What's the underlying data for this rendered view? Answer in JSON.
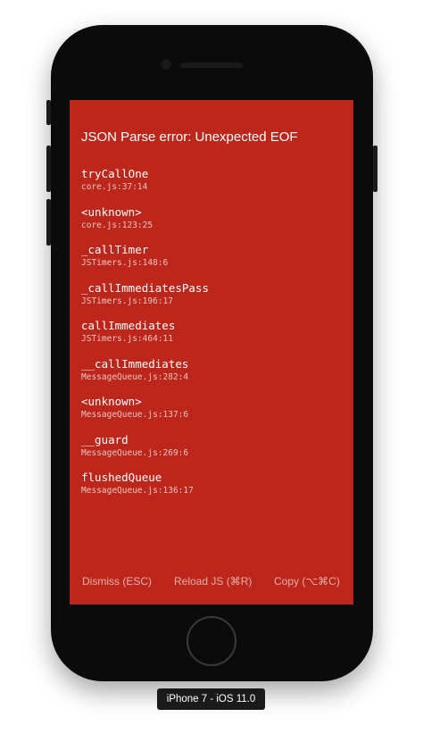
{
  "error": {
    "title": "JSON Parse error: Unexpected EOF"
  },
  "stack": [
    {
      "method": "tryCallOne",
      "file": "core.js:37:14"
    },
    {
      "method": "<unknown>",
      "file": "core.js:123:25"
    },
    {
      "method": "_callTimer",
      "file": "JSTimers.js:148:6"
    },
    {
      "method": "_callImmediatesPass",
      "file": "JSTimers.js:196:17"
    },
    {
      "method": "callImmediates",
      "file": "JSTimers.js:464:11"
    },
    {
      "method": "__callImmediates",
      "file": "MessageQueue.js:282:4"
    },
    {
      "method": "<unknown>",
      "file": "MessageQueue.js:137:6"
    },
    {
      "method": "__guard",
      "file": "MessageQueue.js:269:6"
    },
    {
      "method": "flushedQueue",
      "file": "MessageQueue.js:136:17"
    }
  ],
  "actions": {
    "dismiss": "Dismiss (ESC)",
    "reload": "Reload JS (⌘R)",
    "copy": "Copy (⌥⌘C)"
  },
  "device": {
    "label": "iPhone 7 - iOS 11.0"
  },
  "colors": {
    "error_background": "#bc261b",
    "phone_body": "#0b0b0b"
  }
}
